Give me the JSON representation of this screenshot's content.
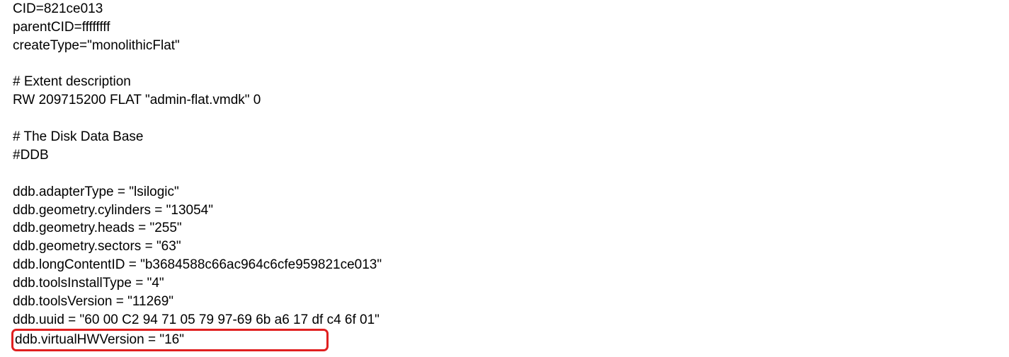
{
  "file": {
    "lines": {
      "cid": "CID=821ce013",
      "parentCID": "parentCID=ffffffff",
      "createType": "createType=\"monolithicFlat\"",
      "extentComment": "# Extent description",
      "extentLine": "RW 209715200 FLAT \"admin-flat.vmdk\" 0",
      "ddbComment": "# The Disk Data Base",
      "ddbHeader": "#DDB",
      "adapterType": "ddb.adapterType = \"lsilogic\"",
      "cylinders": "ddb.geometry.cylinders = \"13054\"",
      "heads": "ddb.geometry.heads = \"255\"",
      "sectors": "ddb.geometry.sectors = \"63\"",
      "longContentID": "ddb.longContentID = \"b3684588c66ac964c6cfe959821ce013\"",
      "toolsInstallType": "ddb.toolsInstallType = \"4\"",
      "toolsVersion": "ddb.toolsVersion = \"11269\"",
      "uuid": "ddb.uuid = \"60 00 C2 94 71 05 79 97-69 6b a6 17 df c4 6f 01\"",
      "virtualHWVersion": "ddb.virtualHWVersion = \"16\"                                     "
    }
  }
}
